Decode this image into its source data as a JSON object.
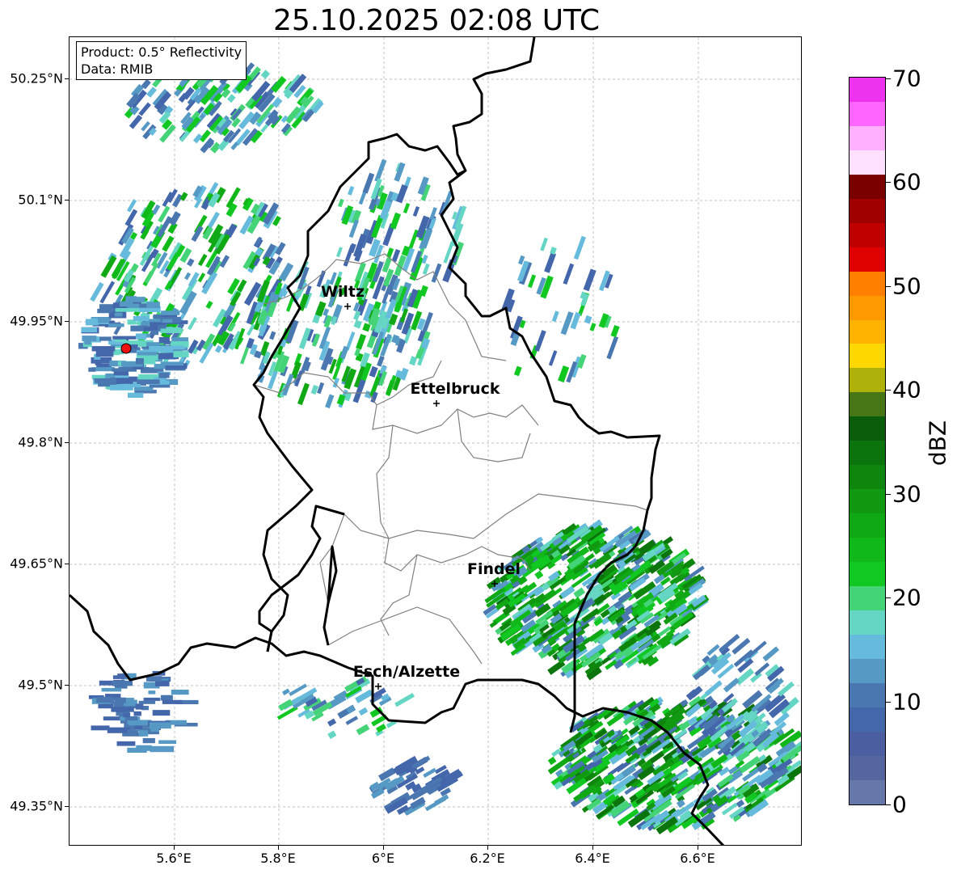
{
  "title": "25.10.2025 02:08 UTC",
  "info_box": {
    "product": "Product: 0.5° Reflectivity",
    "data": "Data: RMIB"
  },
  "lat_labels": [
    "50.25°N",
    "50.1°N",
    "49.95°N",
    "49.8°N",
    "49.65°N",
    "49.5°N",
    "49.35°N"
  ],
  "lon_labels": [
    "5.6°E",
    "5.8°E",
    "6°E",
    "6.2°E",
    "6.4°E",
    "6.6°E"
  ],
  "cities": [
    "Wiltz",
    "Ettelbruck",
    "Findel",
    "Esch/Alzette"
  ],
  "colorbar": {
    "unit": "dBZ",
    "ticks": [
      "0",
      "10",
      "20",
      "30",
      "40",
      "50",
      "60",
      "70"
    ],
    "colors": [
      "#6677aa",
      "#55669e",
      "#4a5ea0",
      "#4466aa",
      "#4a77b0",
      "#5599c4",
      "#66bbdd",
      "#66d6c4",
      "#44d477",
      "#11c822",
      "#11b81a",
      "#11a816",
      "#119912",
      "#0e860e",
      "#0c740c",
      "#0a5d0a",
      "#467616",
      "#b0b00a",
      "#ffd700",
      "#ffb300",
      "#ff9900",
      "#ff7f00",
      "#e00000",
      "#c00000",
      "#a00000",
      "#7a0000",
      "#ffe0ff",
      "#ffb0ff",
      "#ff66ff",
      "#ee33ee"
    ]
  },
  "colors": {
    "radar_site": "#ee1111",
    "border": "#000000",
    "district": "#808080",
    "grid": "#aaaaaa"
  }
}
